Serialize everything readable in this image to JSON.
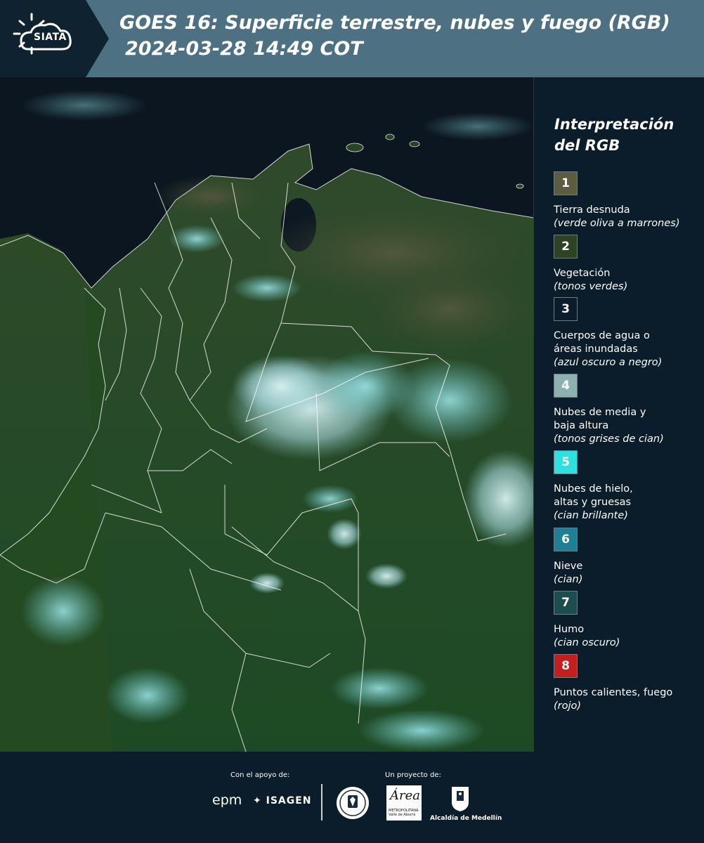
{
  "header": {
    "logo_text": "SIATA",
    "title_line1": "GOES 16: Superficie terrestre, nubes y fuego (RGB)",
    "title_line2": "2024-03-28 14:49 COT"
  },
  "legend": {
    "title_line1": "Interpretación",
    "title_line2": "del RGB",
    "items": [
      {
        "number": "1",
        "color": "#5e5c40",
        "label": "Tierra desnuda",
        "desc": "(verde oliva a marrones)"
      },
      {
        "number": "2",
        "color": "#2d4322",
        "label": "Vegetación",
        "desc": "(tonos verdes)"
      },
      {
        "number": "3",
        "color": "#0b1d2a",
        "label": "Cuerpos de agua o áreas inundadas",
        "desc": "(azul oscuro a negro)"
      },
      {
        "number": "4",
        "color": "#8fb0b0",
        "label": "Nubes de media y baja altura",
        "desc": "(tonos grises de cian)"
      },
      {
        "number": "5",
        "color": "#2fe0e0",
        "label": "Nubes de hielo, altas y gruesas",
        "desc": "(cian brillante)"
      },
      {
        "number": "6",
        "color": "#1f7f96",
        "label": "Nieve",
        "desc": "(cian)"
      },
      {
        "number": "7",
        "color": "#1e4d50",
        "label": "Humo",
        "desc": "(cian oscuro)"
      },
      {
        "number": "8",
        "color": "#c21f1f",
        "label": "Puntos calientes, fuego",
        "desc": "(rojo)"
      }
    ]
  },
  "footer": {
    "support_label": "Con el apoyo de:",
    "project_label": "Un proyecto de:",
    "epm_text": "epm",
    "isagen_text": "ISAGEN",
    "area_text": "Área",
    "area_sub": "METROPOLITANA Valle de Aburrá",
    "alcaldia_text": "Alcaldía de Medellín"
  }
}
